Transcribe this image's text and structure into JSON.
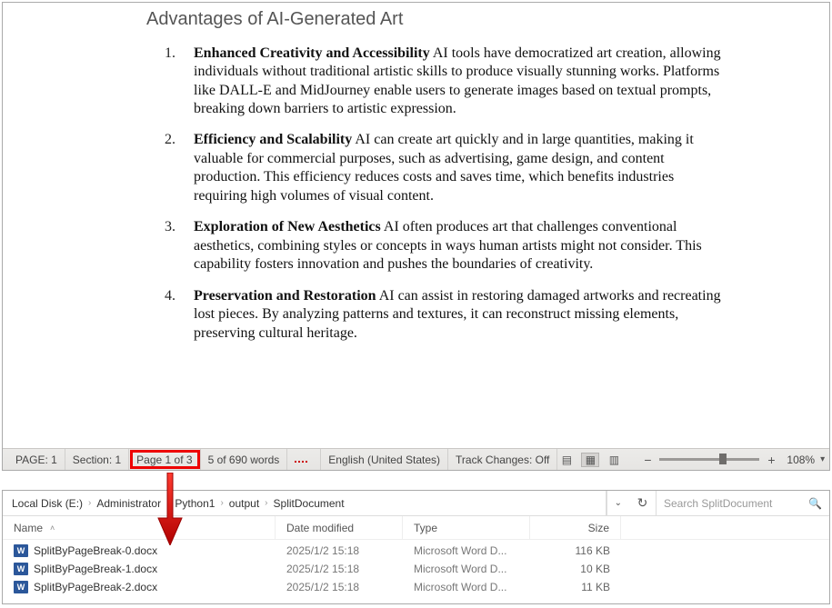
{
  "document": {
    "title": "Advantages of AI-Generated Art",
    "items": [
      {
        "num": "1.",
        "head": "Enhanced Creativity and Accessibility",
        "body": " AI tools have democratized art creation, allowing individuals without traditional artistic skills to produce visually stunning works. Platforms like DALL-E and MidJourney enable users to generate images based on textual prompts, breaking down barriers to artistic expression."
      },
      {
        "num": "2.",
        "head": "Efficiency and Scalability",
        "body": " AI can create art quickly and in large quantities, making it valuable for commercial purposes, such as advertising, game design, and content production. This efficiency reduces costs and saves time, which benefits industries requiring high volumes of visual content."
      },
      {
        "num": "3.",
        "head": "Exploration of New Aesthetics",
        "body": " AI often produces art that challenges conventional aesthetics, combining styles or concepts in ways human artists might not consider. This capability fosters innovation and pushes the boundaries of creativity."
      },
      {
        "num": "4.",
        "head": "Preservation and Restoration",
        "body": " AI can assist in restoring damaged artworks and recreating lost pieces. By analyzing patterns and textures, it can reconstruct missing elements, preserving cultural heritage."
      }
    ]
  },
  "statusbar": {
    "page_label": "PAGE: 1",
    "section_label": "Section: 1",
    "page_of": "Page 1 of 3",
    "words": "5 of 690 words",
    "language": "English (United States)",
    "track": "Track Changes: Off",
    "zoom": "108%"
  },
  "explorer": {
    "crumbs": [
      "Local Disk (E:)",
      "Administrator",
      "Python1",
      "output",
      "SplitDocument"
    ],
    "search_placeholder": "Search SplitDocument",
    "headers": {
      "name": "Name",
      "date": "Date modified",
      "type": "Type",
      "size": "Size"
    },
    "rows": [
      {
        "name": "SplitByPageBreak-0.docx",
        "date": "2025/1/2 15:18",
        "type": "Microsoft Word D...",
        "size": "116 KB"
      },
      {
        "name": "SplitByPageBreak-1.docx",
        "date": "2025/1/2 15:18",
        "type": "Microsoft Word D...",
        "size": "10 KB"
      },
      {
        "name": "SplitByPageBreak-2.docx",
        "date": "2025/1/2 15:18",
        "type": "Microsoft Word D...",
        "size": "11 KB"
      }
    ]
  }
}
